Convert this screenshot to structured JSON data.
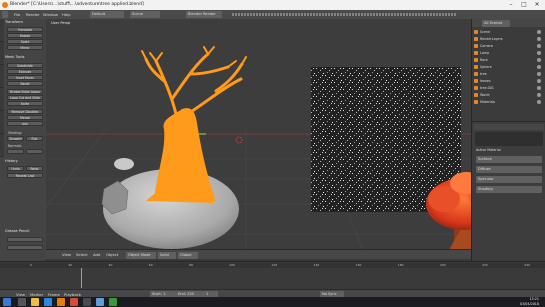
{
  "window": {
    "title": "Blender* [C:\\Users\\...\\stuff\\...\\adventure\\tree applied.blend]",
    "minimize": "–",
    "maximize": "□",
    "close": "✕"
  },
  "info_header": {
    "menus": [
      "File",
      "Render",
      "Window",
      "Help"
    ],
    "layout": "Default",
    "scene": "Scene",
    "engine": "Blender Render"
  },
  "tool_shelf": {
    "panels": [
      {
        "title": "Transform",
        "buttons": [
          "Translate",
          "Rotate",
          "Scale",
          "Mirror"
        ]
      },
      {
        "title": "Mesh Tools",
        "buttons": [
          "Subdivide",
          "Extrude",
          "Inset Faces",
          "Bevel",
          "Bridge Edge Loops",
          "Loop Cut and Slide",
          "Knife",
          "Remove Doubles",
          "Merge",
          "Join"
        ]
      },
      {
        "title": "History",
        "buttons": [
          "Undo",
          "Redo",
          "Repeat Last"
        ]
      }
    ],
    "toggles": [
      "Smooth",
      "Flat"
    ],
    "labels": [
      "Shading:",
      "Normals:",
      "Grease Pencil"
    ]
  },
  "viewport": {
    "label": "User Persp",
    "header": {
      "menus": [
        "View",
        "Select",
        "Add",
        "Object"
      ],
      "mode": "Object Mode",
      "shading": "Solid",
      "pivot": "Global"
    }
  },
  "outliner": {
    "view": "All Scenes",
    "rows": [
      "Scene",
      "RenderLayers",
      "Camera",
      "Lamp",
      "Rock",
      "Sphere",
      "tree",
      "leaves",
      "tree.001",
      "World",
      "Materials"
    ]
  },
  "properties": {
    "header": "Active Material",
    "rows": [
      "Surface",
      "Diffuse",
      "Specular",
      "Shading"
    ]
  },
  "timeline": {
    "menus": [
      "View",
      "Marker",
      "Frame",
      "Playback"
    ],
    "start_label": "Start: 1",
    "end_label": "End: 250",
    "current_frame": "1",
    "ticks": [
      "0",
      "20",
      "40",
      "60",
      "80",
      "100",
      "120",
      "140",
      "160",
      "180",
      "200",
      "220",
      "240"
    ],
    "sync": "No Sync"
  },
  "taskbar": {
    "time": "15:21",
    "date": "03/04/2018"
  },
  "colors": {
    "tree_orange": "#ff9a1a",
    "rock_gray": "#b8b8b8",
    "blender_orange": "#e87d0d"
  }
}
